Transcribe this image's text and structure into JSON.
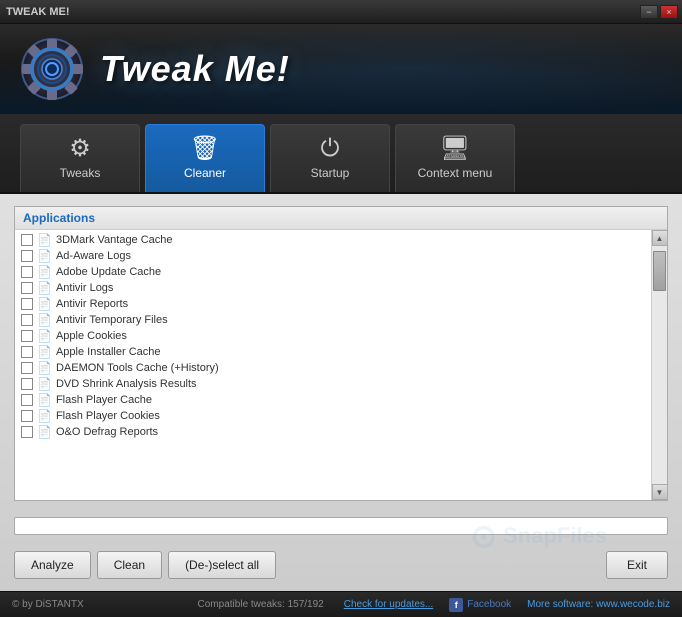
{
  "titlebar": {
    "title": "TWEAK ME!",
    "min_label": "−",
    "close_label": "×"
  },
  "header": {
    "app_name": "Tweak Me!"
  },
  "nav": {
    "tabs": [
      {
        "id": "tweaks",
        "label": "Tweaks",
        "icon": "⚙",
        "active": false
      },
      {
        "id": "cleaner",
        "label": "Cleaner",
        "icon": "🗑",
        "active": true
      },
      {
        "id": "startup",
        "label": "Startup",
        "icon": "⏻",
        "active": false
      },
      {
        "id": "context_menu",
        "label": "Context menu",
        "icon": "🖥",
        "active": false
      }
    ]
  },
  "cleaner": {
    "section_label": "Applications",
    "items": [
      {
        "label": "3DMark Vantage Cache"
      },
      {
        "label": "Ad-Aware Logs"
      },
      {
        "label": "Adobe Update Cache"
      },
      {
        "label": "Antivir Logs"
      },
      {
        "label": "Antivir Reports"
      },
      {
        "label": "Antivir Temporary Files"
      },
      {
        "label": "Apple Cookies"
      },
      {
        "label": "Apple Installer Cache"
      },
      {
        "label": "DAEMON Tools Cache (+History)"
      },
      {
        "label": "DVD Shrink Analysis Results"
      },
      {
        "label": "Flash Player Cache"
      },
      {
        "label": "Flash Player Cookies"
      },
      {
        "label": "O&O Defrag Reports"
      }
    ]
  },
  "buttons": {
    "analyze": "Analyze",
    "clean": "Clean",
    "deselect_all": "(De-)select all",
    "exit": "Exit"
  },
  "footer": {
    "credit": "© by DiSTANTX",
    "compat": "Compatible tweaks: 157/192",
    "check_updates": "Check for updates...",
    "facebook": "Facebook",
    "more_software": "More software: www.wecode.biz"
  }
}
